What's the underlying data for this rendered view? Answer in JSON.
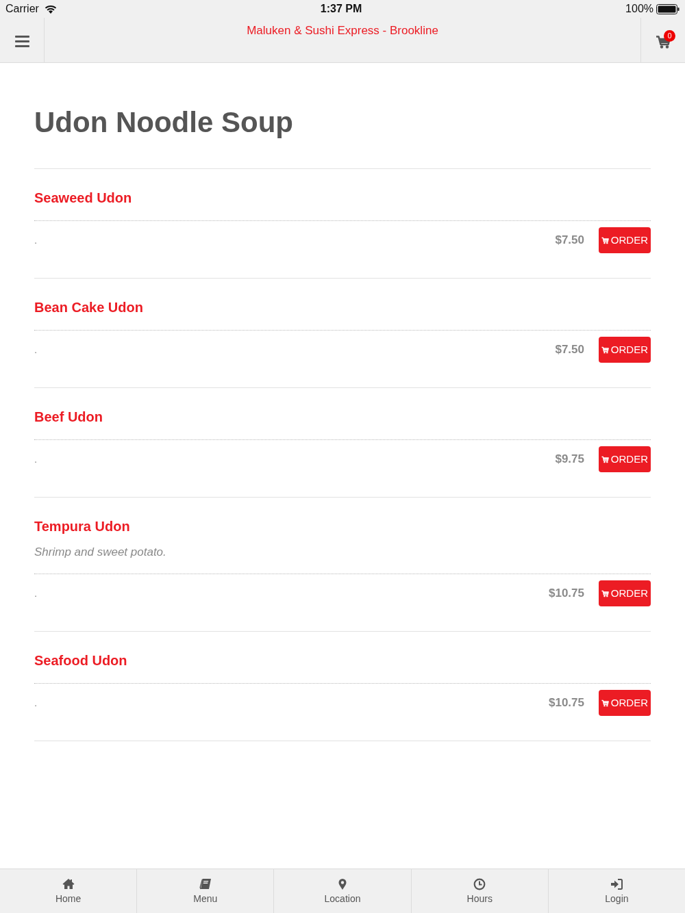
{
  "status_bar": {
    "carrier": "Carrier",
    "time": "1:37 PM",
    "battery": "100%"
  },
  "header": {
    "title": "Maluken & Sushi Express - Brookline",
    "cart_count": "0"
  },
  "category": {
    "title": "Udon Noodle Soup"
  },
  "items": [
    {
      "name": "Seaweed Udon",
      "label": ".",
      "price": "$7.50",
      "button": "ORDER"
    },
    {
      "name": "Bean Cake Udon",
      "label": ".",
      "price": "$7.50",
      "button": "ORDER"
    },
    {
      "name": "Beef Udon",
      "label": ".",
      "price": "$9.75",
      "button": "ORDER"
    },
    {
      "name": "Tempura Udon",
      "description": "Shrimp and sweet potato.",
      "label": ".",
      "price": "$10.75",
      "button": "ORDER"
    },
    {
      "name": "Seafood Udon",
      "label": ".",
      "price": "$10.75",
      "button": "ORDER"
    }
  ],
  "tab_bar": [
    {
      "label": "Home",
      "kind": "home"
    },
    {
      "label": "Menu",
      "kind": "menu"
    },
    {
      "label": "Location",
      "kind": "location"
    },
    {
      "label": "Hours",
      "kind": "hours"
    },
    {
      "label": "Login",
      "kind": "login"
    }
  ]
}
